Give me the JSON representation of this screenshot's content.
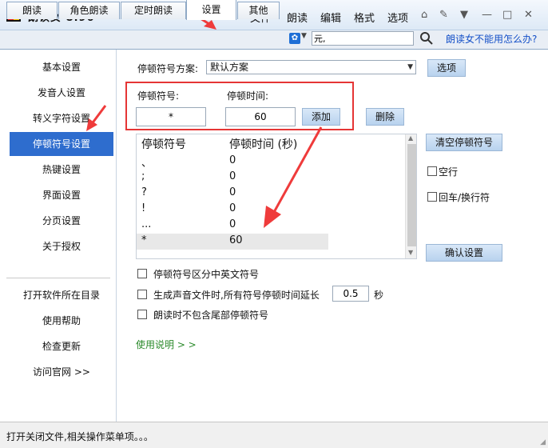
{
  "app": {
    "title": "朗读女  8.96"
  },
  "menu": [
    "文件*",
    "朗读",
    "编辑",
    "格式",
    "选项"
  ],
  "tabs": [
    "朗读",
    "角色朗读",
    "定时朗读",
    "设置",
    "其他"
  ],
  "search": {
    "value": "元,"
  },
  "help_link": "朗读女不能用怎么办?",
  "sidebar": {
    "items": [
      "基本设置",
      "发音人设置",
      "转义字符设置",
      "停顿符号设置",
      "热键设置",
      "界面设置",
      "分页设置",
      "关于授权"
    ],
    "links": [
      "打开软件所在目录",
      "使用帮助",
      "检查更新",
      "访问官网 >>"
    ]
  },
  "settings": {
    "scheme_label": "停顿符号方案:",
    "scheme_value": "默认方案",
    "options_button": "选项",
    "symbol_label": "停顿符号:",
    "time_label": "停顿时间:",
    "symbol_value": "*",
    "time_value": "60",
    "add_button": "添加",
    "delete_button": "删除",
    "list_header_symbol": "停顿符号",
    "list_header_time": "停顿时间 (秒)",
    "rows": [
      {
        "symbol": "、",
        "time": "0"
      },
      {
        "symbol": ";",
        "time": "0"
      },
      {
        "symbol": "?",
        "time": "0"
      },
      {
        "symbol": "!",
        "time": "0"
      },
      {
        "symbol": "...",
        "time": "0"
      },
      {
        "symbol": "*",
        "time": "60"
      }
    ],
    "clear_button": "清空停顿符号",
    "empty_line_label": "空行",
    "newline_label": "回车/换行符",
    "confirm_button": "确认设置",
    "option1": "停顿符号区分中英文符号",
    "option2_prefix": "生成声音文件时,所有符号停顿时间延长",
    "option2_value": "0.5",
    "option2_suffix": "秒",
    "option3": "朗读时不包含尾部停顿符号",
    "usage_link": "使用说明 > >"
  },
  "status": {
    "text": "打开关闭文件,相关操作菜单项。。。"
  },
  "colors": {
    "accent": "#2e6dce",
    "highlight_border": "#e53535",
    "annotation_arrow": "#ef3b3b",
    "link": "#1450c8",
    "usage_link": "#2a8a2a"
  }
}
